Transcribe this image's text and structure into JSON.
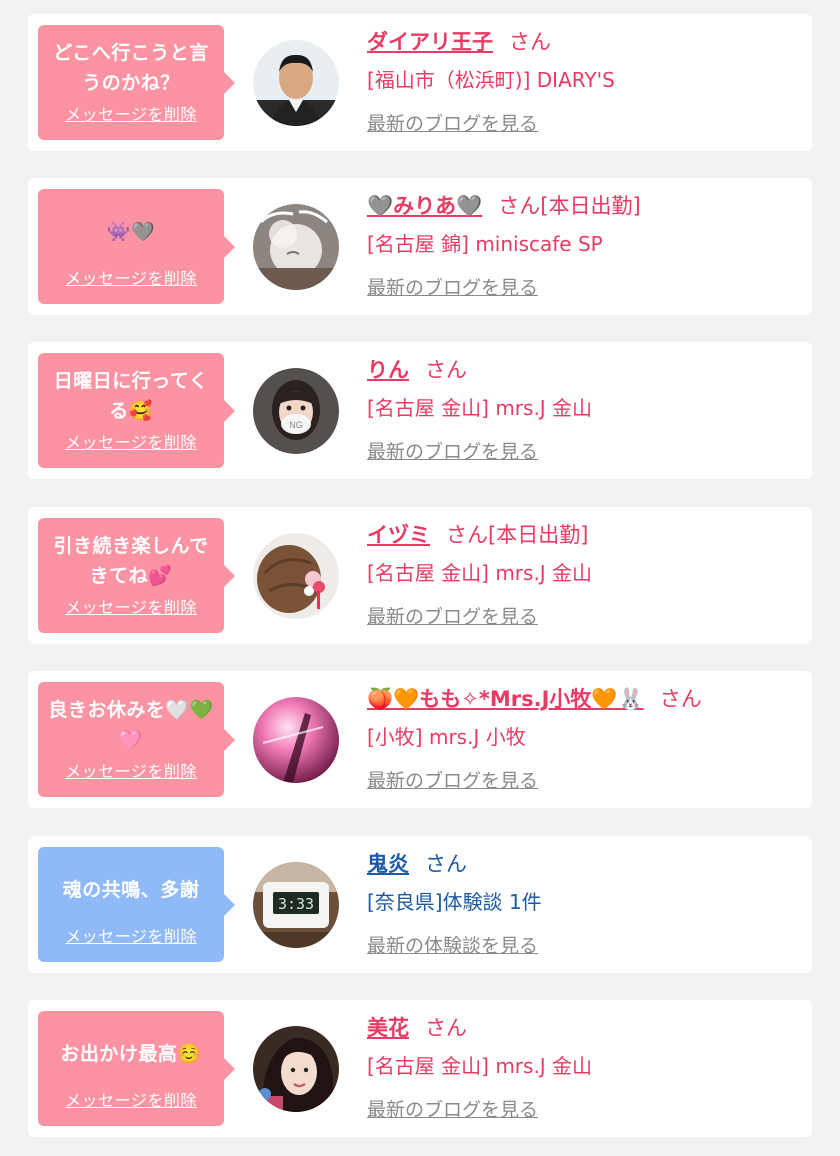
{
  "items": [
    {
      "message": "どこへ行こうと言うのかね？",
      "delete_label": "メッセージを削除",
      "name": "ダイアリ王子",
      "honorific": "さん",
      "shop": "[福山市（松浜町)] DIARY'S",
      "link": "最新のブログを見る",
      "theme": "pink",
      "avatar": "man-portrait"
    },
    {
      "message": "👾🩶",
      "delete_label": "メッセージを削除",
      "name": "🩶みりあ🩶",
      "honorific": "さん[本日出勤]",
      "shop": "[名古屋 錦] miniscafe SP",
      "link": "最新のブログを見る",
      "theme": "pink",
      "avatar": "blurred-face-photo"
    },
    {
      "message": "日曜日に行ってくる🥰",
      "delete_label": "メッセージを削除",
      "name": "りん",
      "honorific": "さん",
      "shop": "[名古屋 金山] mrs.J 金山",
      "link": "最新のブログを見る",
      "theme": "pink",
      "avatar": "masked-girl-photo"
    },
    {
      "message": "引き続き楽しんできてね💕",
      "delete_label": "メッセージを削除",
      "name": "イヅミ",
      "honorific": "さん[本日出勤]",
      "shop": "[名古屋 金山] mrs.J 金山",
      "link": "最新のブログを見る",
      "theme": "pink",
      "avatar": "hair-ornament-photo"
    },
    {
      "message": "良きお休みを🤍💚🩷",
      "delete_label": "メッセージを削除",
      "name": "🍑🧡もも✧*Mrs.J小牧🧡🐰",
      "honorific": "さん",
      "shop": "[小牧] mrs.J 小牧",
      "link": "最新のブログを見る",
      "theme": "pink",
      "avatar": "pink-light-photo"
    },
    {
      "message": "魂の共鳴、多謝",
      "delete_label": "メッセージを削除",
      "name": "鬼炎",
      "honorific": "さん",
      "shop": "[奈良県]体験談 1件",
      "link": "最新の体験談を見る",
      "theme": "blue",
      "avatar": "timer-display-photo"
    },
    {
      "message": "お出かけ最高☺️",
      "delete_label": "メッセージを削除",
      "name": "美花",
      "honorific": "さん",
      "shop": "[名古屋 金山] mrs.J 金山",
      "link": "最新のブログを見る",
      "theme": "pink",
      "avatar": "woman-selfie-photo"
    }
  ],
  "colors": {
    "page_bg": "#f2f2f2",
    "card_bg": "#ffffff",
    "pink_bubble": "#fc93a3",
    "blue_bubble": "#8fb9f7",
    "pink_text": "#e73b63",
    "blue_text": "#1d5aa6",
    "link_gray": "#8a8a8a"
  }
}
